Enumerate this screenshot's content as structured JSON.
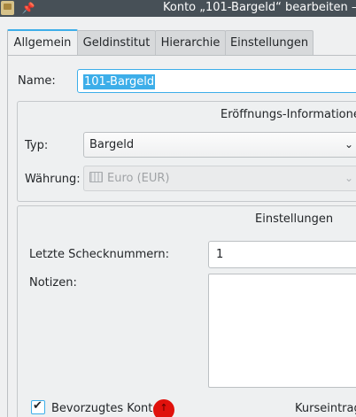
{
  "window": {
    "title": "Konto „101-Bargeld“ bearbeiten —"
  },
  "tabs": [
    {
      "label": "Allgemein",
      "active": true
    },
    {
      "label": "Geldinstitut",
      "active": false
    },
    {
      "label": "Hierarchie",
      "active": false
    },
    {
      "label": "Einstellungen",
      "active": false
    }
  ],
  "general": {
    "name_label": "Name:",
    "name_value": "101-Bargeld"
  },
  "opening": {
    "title": "Eröffnungs-Informatione",
    "type_label": "Typ:",
    "type_value": "Bargeld",
    "currency_label": "Währung:",
    "currency_value": "Euro (EUR)",
    "currency_icon": "currency-icon"
  },
  "settings": {
    "title": "Einstellungen",
    "last_check_label": "Letzte Schecknummern:",
    "last_check_value": "1",
    "notes_label": "Notizen:",
    "notes_value": "",
    "preferred_label": "Bevorzugtes Konto",
    "preferred_checked": true,
    "price_entry_label": "Kurseintrag"
  },
  "colors": {
    "accent": "#3daee9",
    "titlebar": "#475057",
    "background": "#eff0f1",
    "cursor_marker": "#e0110c"
  }
}
